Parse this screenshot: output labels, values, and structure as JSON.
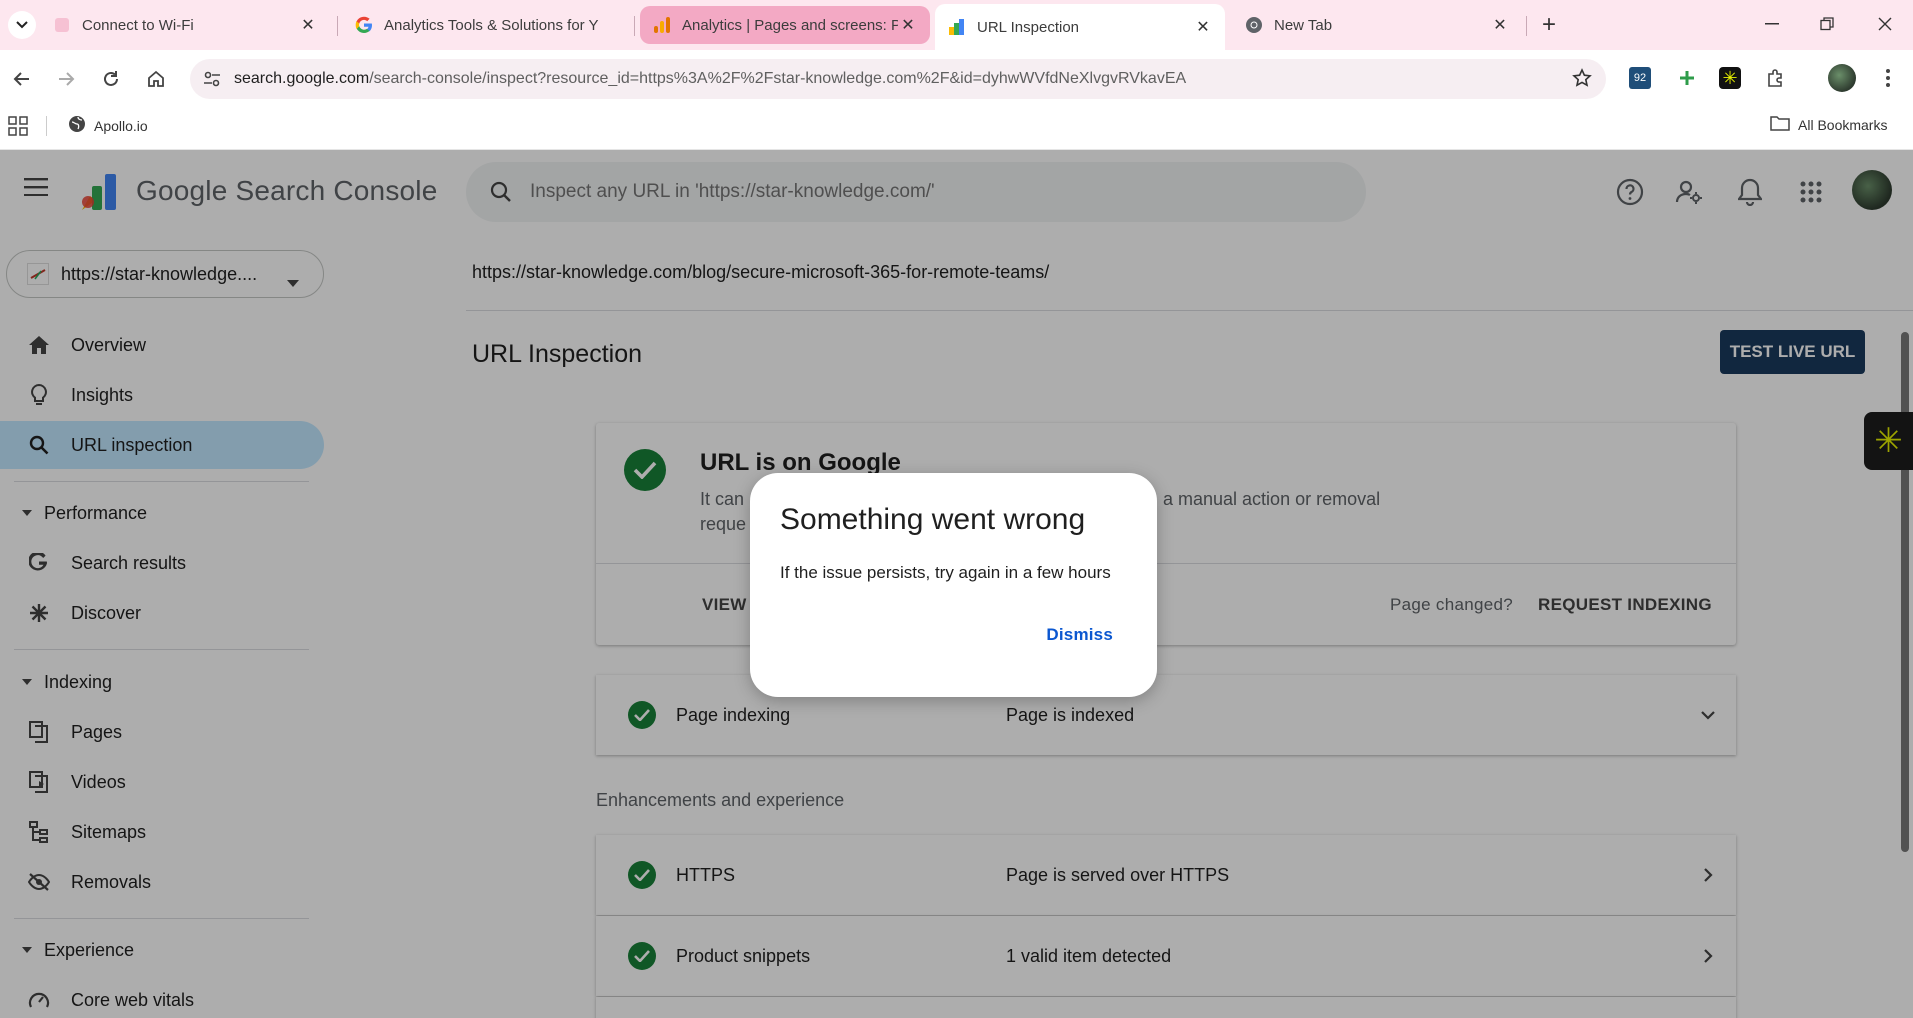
{
  "browser": {
    "tabs": [
      {
        "title": "Connect to Wi-Fi",
        "icon": "pink-blank-icon"
      },
      {
        "title": "Analytics Tools & Solutions for Y",
        "icon": "google-g-icon"
      },
      {
        "title": "Analytics | Pages and screens: P",
        "icon": "analytics-icon"
      },
      {
        "title": "URL Inspection",
        "icon": "search-console-icon"
      },
      {
        "title": "New Tab",
        "icon": "chrome-icon"
      }
    ],
    "url_host": "search.google.com",
    "url_path": "/search-console/inspect?resource_id=https%3A%2F%2Fstar-knowledge.com%2F&id=dyhwWVfdNeXlvgvRVkavEA",
    "ext_badge": "92",
    "bookmarks": {
      "apollo": "Apollo.io",
      "all": "All Bookmarks"
    }
  },
  "header": {
    "product_name": "Google Search Console",
    "search_placeholder": "Inspect any URL in 'https://star-knowledge.com/'"
  },
  "sidebar": {
    "property": "https://star-knowledge....",
    "items": {
      "overview": "Overview",
      "insights": "Insights",
      "url_inspection": "URL inspection",
      "performance": "Performance",
      "search_results": "Search results",
      "discover": "Discover",
      "indexing": "Indexing",
      "pages": "Pages",
      "videos": "Videos",
      "sitemaps": "Sitemaps",
      "removals": "Removals",
      "experience": "Experience",
      "core_web_vitals": "Core web vitals"
    }
  },
  "main": {
    "inspected_url": "https://star-knowledge.com/blog/secure-microsoft-365-for-remote-teams/",
    "title": "URL Inspection",
    "test_live_button": "TEST LIVE URL",
    "status_card": {
      "title": "URL is on Google",
      "desc_left": "It can",
      "desc_right": "a manual action or removal",
      "desc_line2": "reque",
      "view_action": "VIEW",
      "page_changed": "Page changed?",
      "request_indexing": "REQUEST INDEXING"
    },
    "page_indexing": {
      "label": "Page indexing",
      "value": "Page is indexed"
    },
    "enhancements_label": "Enhancements and experience",
    "https": {
      "label": "HTTPS",
      "value": "Page is served over HTTPS"
    },
    "product_snippets": {
      "label": "Product snippets",
      "value": "1 valid item detected"
    }
  },
  "dialog": {
    "title": "Something went wrong",
    "message": "If the issue persists, try again in a few hours",
    "dismiss": "Dismiss"
  },
  "colors": {
    "tabbar_bg": "#fde7ef",
    "active_nav": "#c2e7ff",
    "check_green": "#188038",
    "primary_button": "#1a3a5e",
    "link_blue": "#0b57d0"
  }
}
